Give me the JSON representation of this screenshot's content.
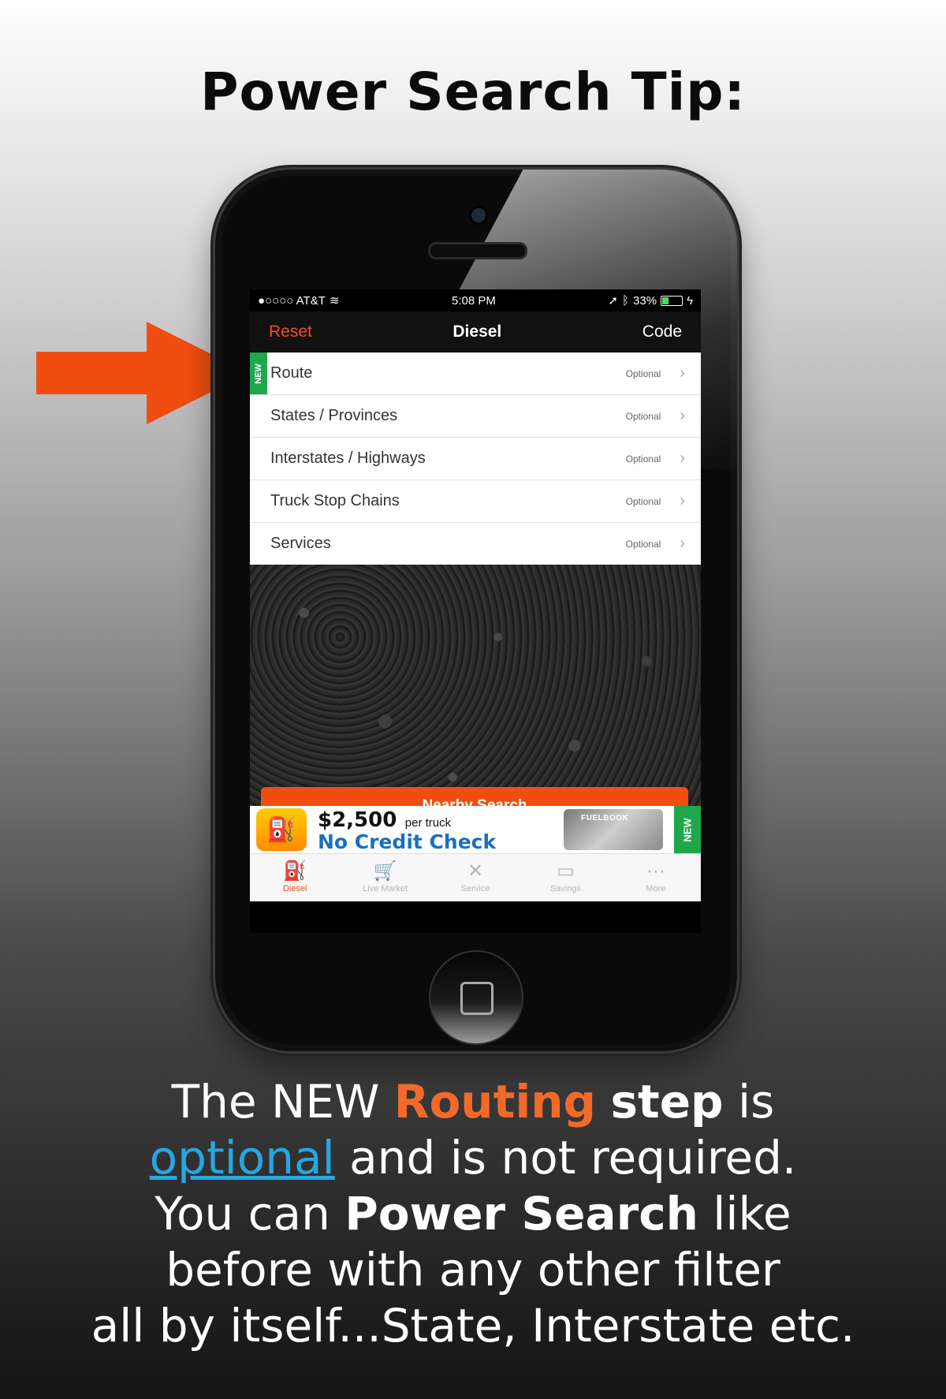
{
  "headline": "Power Search Tip:",
  "colors": {
    "accent": "#f04e23",
    "new_green": "#1fa84b",
    "link_blue": "#28a6e2",
    "routing_orange": "#f26a2a"
  },
  "status_bar": {
    "carrier": "●○○○○ AT&T",
    "time": "5:08 PM",
    "battery": "33%",
    "battery_level": 0.33
  },
  "nav": {
    "left": "Reset",
    "title": "Diesel",
    "right": "Code"
  },
  "new_tag": "NEW",
  "filters": [
    {
      "label": "Route",
      "status": "Optional",
      "is_new": true
    },
    {
      "label": "States / Provinces",
      "status": "Optional"
    },
    {
      "label": "Interstates / Highways",
      "status": "Optional"
    },
    {
      "label": "Truck Stop Chains",
      "status": "Optional"
    },
    {
      "label": "Services",
      "status": "Optional"
    }
  ],
  "search_button": "Nearby Search",
  "ad": {
    "amount": "$2,500",
    "per": "per truck",
    "headline": "No Credit Check",
    "brand": "FUELBOOK",
    "badge": "NEW"
  },
  "tabs": [
    {
      "label": "Diesel",
      "icon": "fuel-pump-icon",
      "active": true
    },
    {
      "label": "Live Market",
      "icon": "cart-icon"
    },
    {
      "label": "Service",
      "icon": "tools-icon"
    },
    {
      "label": "Savings",
      "icon": "card-icon"
    },
    {
      "label": "More",
      "icon": "more-dots-icon"
    }
  ],
  "caption": {
    "line1": {
      "a": "The NEW ",
      "routing": "Routing",
      "b": " ",
      "step": "step",
      "c": " is"
    },
    "line2": {
      "optional": "optional",
      "rest": " and is not required."
    },
    "line3": {
      "a": "You can ",
      "power": "Power Search",
      "b": " like"
    },
    "line4": "before with any other filter",
    "line5": "all by itself...State, Interstate etc."
  }
}
